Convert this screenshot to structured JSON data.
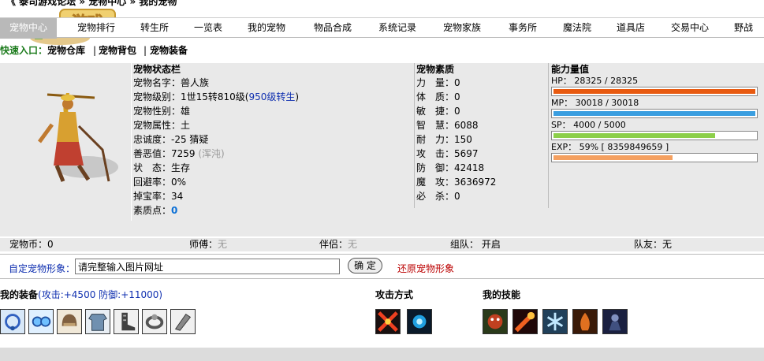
{
  "breadcrumb": "《 泰司游戏论坛 » 宠物中心 » 我的宠物",
  "logo_text": "游戏",
  "nav": [
    "宠物中心",
    "宠物排行",
    "转生所",
    "一览表",
    "我的宠物",
    "物品合成",
    "系统记录",
    "宠物家族",
    "事务所",
    "魔法院",
    "道具店",
    "交易中心",
    "野战"
  ],
  "subbar": {
    "fast_label": "快速入口：",
    "links": [
      "宠物仓库",
      "宠物背包",
      "宠物装备"
    ],
    "sep": "|"
  },
  "status": {
    "title": "宠物状态栏",
    "name": "宠物名字：兽人族",
    "level_prefix": "宠物级别：1世15转810级(",
    "level_link": "950级转生",
    "level_suffix": ")",
    "gender": "宠物性别：雄",
    "attribute": "宠物属性：土",
    "loyalty": "忠诚度：-25 猜疑",
    "karma_prefix": "善恶值：7259 ",
    "karma_tag": "(浑沌)",
    "state": "状　态：生存",
    "evade": "回避率：0%",
    "drop": "掉宝率：34",
    "points_prefix": "素质点：",
    "points_value": "0"
  },
  "quality": {
    "title": "宠物素质",
    "rows": [
      "力　量：0",
      "体　质：0",
      "敏　捷：0",
      "智　慧：6088",
      "耐　力：150",
      "攻　击：5697",
      "防　御：42418",
      "魔　攻：3636972",
      "必　杀：0"
    ]
  },
  "ability": {
    "title": "能力量值",
    "hp": "HP： 28325 / 28325",
    "mp": "MP： 30018 / 30018",
    "sp": "SP： 4000 / 5000",
    "exp": "EXP： 59% [ 8359849659 ]",
    "hp_fill": 1.0,
    "mp_fill": 1.0,
    "sp_fill": 0.8,
    "exp_fill": 0.59,
    "colors": {
      "hp": "#e85a10",
      "mp": "#3a9ee0",
      "sp": "#8ccf4a",
      "exp": "#f4a060"
    }
  },
  "statrow": {
    "coins": "宠物币：0",
    "master_label": "师傅：",
    "master_value": "无",
    "partner_label": "伴侣：",
    "partner_value": "无",
    "team": "组队：  开启",
    "teammate": "队友：无"
  },
  "custom": {
    "label": "自定宠物形象：",
    "input_value": "请完整输入图片网址",
    "confirm": "确 定",
    "restore": "还原宠物形象"
  },
  "equip": {
    "title": "我的装备",
    "stats": "(攻击:+4500 防御:+11000)",
    "icons": [
      "necklace-icon",
      "goggles-icon",
      "helmet-icon",
      "armor-icon",
      "boots-icon",
      "ring-icon",
      "gauntlet-icon"
    ]
  },
  "attack": {
    "title": "攻击方式",
    "icons": [
      "fire-cross-icon",
      "swirl-icon"
    ]
  },
  "skills": {
    "title": "我的技能",
    "icons": [
      "beast-skill-icon",
      "fireball-skill-icon",
      "frost-skill-icon",
      "flame-skill-icon",
      "dark-knight-skill-icon"
    ]
  }
}
